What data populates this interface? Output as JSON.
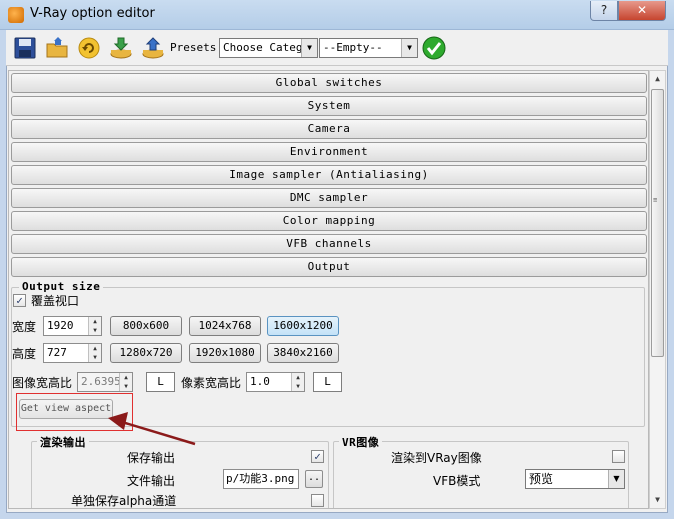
{
  "window": {
    "title": "V-Ray option editor",
    "help_label": "?",
    "close_label": "✕"
  },
  "toolbar": {
    "presets_label": "Presets:",
    "category_value": "Choose Catego",
    "preset_value": "--Empty--",
    "icons": [
      "save-icon",
      "open-icon",
      "reset-icon",
      "import-icon",
      "export-icon",
      "apply-check-icon"
    ]
  },
  "rollouts": [
    "Global switches",
    "System",
    "Camera",
    "Environment",
    "Image sampler (Antialiasing)",
    "DMC sampler",
    "Color mapping",
    "VFB channels",
    "Output"
  ],
  "output_size": {
    "title": "Output size",
    "override_viewport_label": "覆盖视口",
    "override_checked": "✓",
    "width_label": "宽度",
    "width_value": "1920",
    "height_label": "高度",
    "height_value": "727",
    "presets_row1": [
      "800x600",
      "1024x768",
      "1600x1200"
    ],
    "presets_row2": [
      "1280x720",
      "1920x1080",
      "3840x2160"
    ],
    "aspect_label": "图像宽高比",
    "aspect_value": "2.63953",
    "lock_label": "L",
    "pixel_aspect_label": "像素宽高比",
    "pixel_aspect_value": "1.0",
    "pixel_lock_label": "L",
    "get_view_aspect_label": "Get view aspect"
  },
  "render_output": {
    "title": "渲染输出",
    "save_output_label": "保存输出",
    "save_output_checked": "✓",
    "file_output_label": "文件输出",
    "file_path": "p/功能3.png",
    "browse_label": "..",
    "separate_alpha_label": "单独保存alpha通道"
  },
  "vfb": {
    "title": "VR图像",
    "render_to_vfb_label": "渲染到VRay图像",
    "vfb_mode_label": "VFB模式",
    "vfb_mode_value": "预览"
  },
  "scrollbar": {
    "up_arrow": "▲",
    "down_arrow": "▼",
    "grip": "≡"
  },
  "colors": {
    "highlight": "#e03030",
    "arrow": "#8b1a1a",
    "selected_preset": "#c3e2f7"
  }
}
